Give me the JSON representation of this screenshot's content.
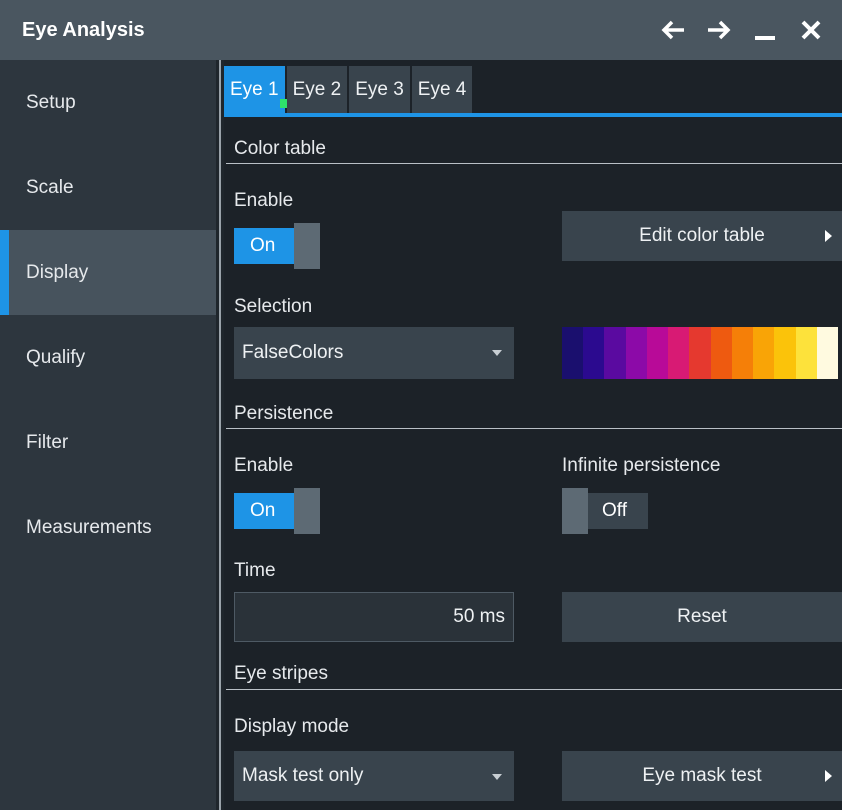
{
  "window": {
    "title": "Eye Analysis",
    "controls": [
      "back-icon",
      "forward-icon",
      "minimize-icon",
      "close-icon"
    ]
  },
  "sidebar": {
    "items": [
      {
        "label": "Setup"
      },
      {
        "label": "Scale"
      },
      {
        "label": "Display",
        "active": true
      },
      {
        "label": "Qualify"
      },
      {
        "label": "Filter"
      },
      {
        "label": "Measurements"
      }
    ]
  },
  "tabs": [
    {
      "label": "Eye 1",
      "active": true
    },
    {
      "label": "Eye 2"
    },
    {
      "label": "Eye 3"
    },
    {
      "label": "Eye 4"
    }
  ],
  "color_table": {
    "section_title": "Color table",
    "enable_label": "Enable",
    "enable_value": "On",
    "edit_button": "Edit color table",
    "selection_label": "Selection",
    "selection_value": "FalseColors",
    "palette": [
      "#1a0f6e",
      "#2b0a8f",
      "#5a0aa0",
      "#8c0aa8",
      "#b80a98",
      "#d81a74",
      "#e5392f",
      "#ee5a10",
      "#f57f08",
      "#f9a406",
      "#fbc30a",
      "#fde23b",
      "#fffae0"
    ]
  },
  "persistence": {
    "section_title": "Persistence",
    "enable_label": "Enable",
    "enable_value": "On",
    "infinite_label": "Infinite persistence",
    "infinite_value": "Off",
    "time_label": "Time",
    "time_value": "50 ms",
    "reset_button": "Reset"
  },
  "eye_stripes": {
    "section_title": "Eye stripes",
    "display_mode_label": "Display mode",
    "display_mode_value": "Mask test only",
    "mask_button": "Eye mask test"
  },
  "colors": {
    "accent": "#1e94e6",
    "titlebar": "#4a5660",
    "sidebar": "#2d363e",
    "panel": "#1c2228",
    "button": "#39444d",
    "status_dot": "#2ee36b"
  }
}
